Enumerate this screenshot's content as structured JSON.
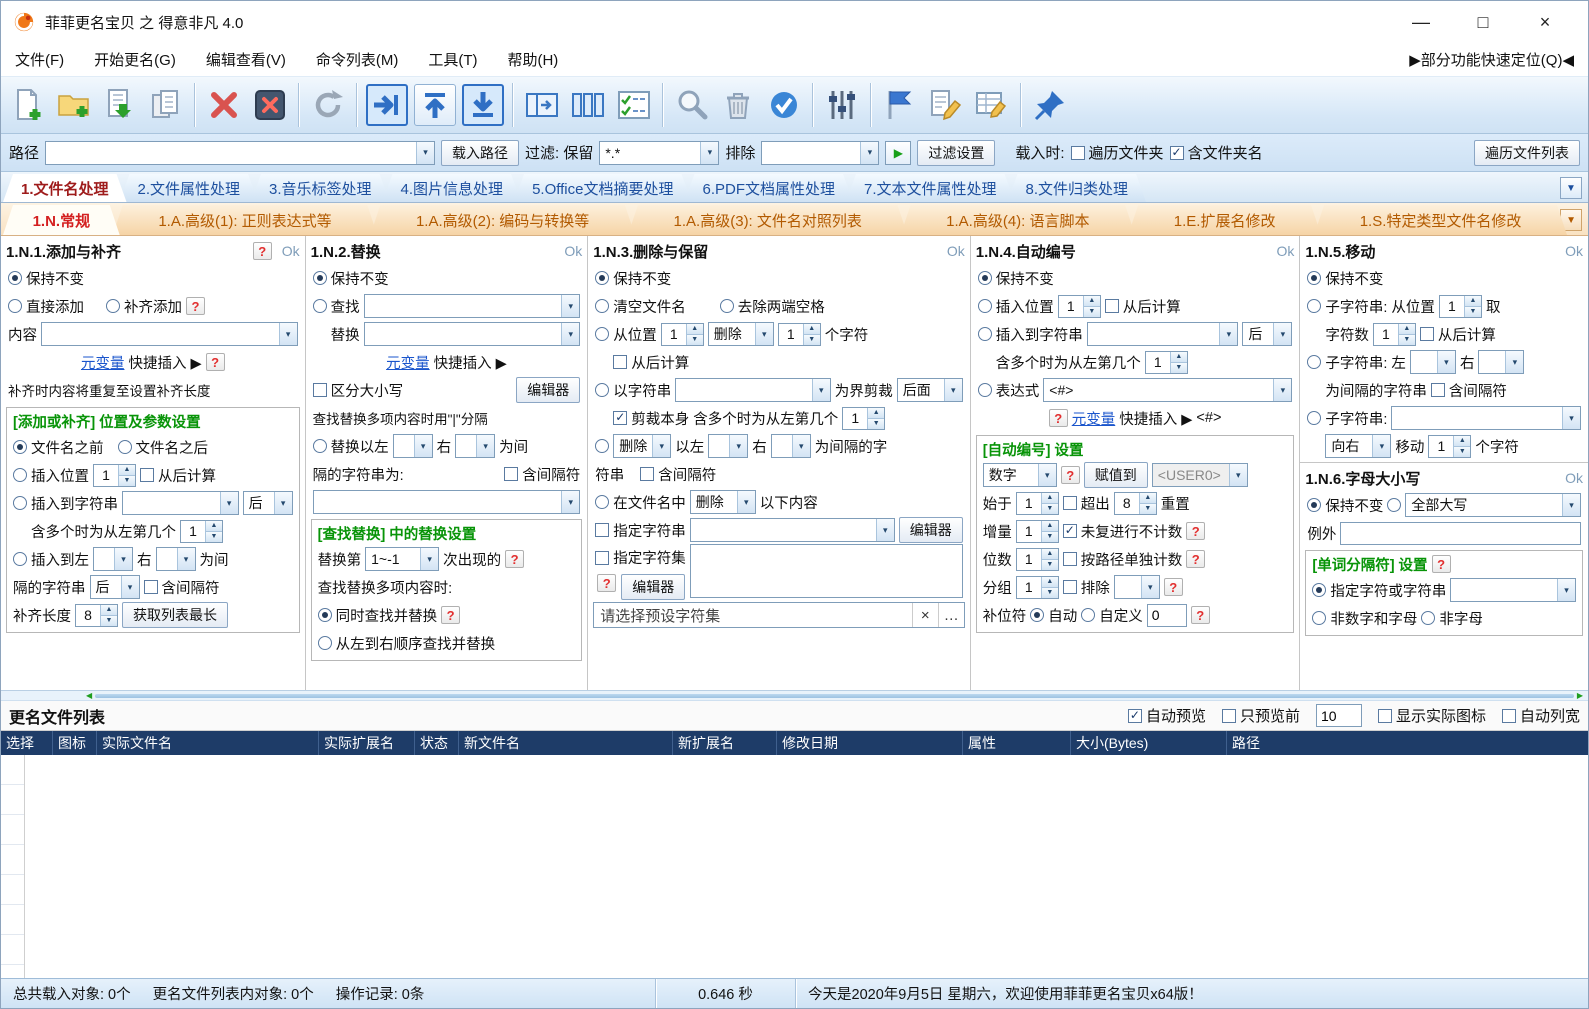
{
  "icons": {
    "combo_arrow": "▾",
    "spin_up": "▲",
    "spin_down": "▼",
    "dropdown_arrow": "▼",
    "play": "▶",
    "question": "?",
    "close_x": "×",
    "more": "…",
    "left_arrow": "◀",
    "right_arrow": "▶"
  },
  "window": {
    "title": "菲菲更名宝贝 之 得意非凡 4.0",
    "minimize": "—",
    "maximize": "□",
    "close": "×"
  },
  "menubar": {
    "items": [
      "文件(F)",
      "开始更名(G)",
      "编辑查看(V)",
      "命令列表(M)",
      "工具(T)",
      "帮助(H)"
    ],
    "quick_locate": "▶部分功能快速定位(Q)◀"
  },
  "toolbar": {
    "icons": [
      "new-list",
      "open-folder",
      "load-list",
      "save-list",
      "delete",
      "close-list",
      "refresh",
      "move-right",
      "move-up",
      "move-down",
      "split-view",
      "column-view",
      "form-view",
      "search",
      "clear-list",
      "apply",
      "options",
      "filter-flag",
      "edit-name",
      "edit-list",
      "pin"
    ]
  },
  "pathbar": {
    "path_label": "路径",
    "load_path_btn": "载入路径",
    "filter_label": "过滤: 保留",
    "filter_value": "*.*",
    "exclude_label": "排除",
    "filter_settings_btn": "过滤设置",
    "load_when_label": "载入时:",
    "traverse_folders_cb": "遍历文件夹",
    "include_folder_cb": "含文件夹名",
    "traverse_list_btn": "遍历文件列表"
  },
  "maintabs": [
    "1.文件名处理",
    "2.文件属性处理",
    "3.音乐标签处理",
    "4.图片信息处理",
    "5.Office文档摘要处理",
    "6.PDF文档属性处理",
    "7.文本文件属性处理",
    "8.文件归类处理"
  ],
  "subtabs": [
    "1.N.常规",
    "1.A.高级(1): 正则表达式等",
    "1.A.高级(2): 编码与转换等",
    "1.A.高级(3): 文件名对照列表",
    "1.A.高级(4): 语言脚本",
    "1.E.扩展名修改",
    "1.S.特定类型文件名修改"
  ],
  "p1": {
    "title": "1.N.1.添加与补齐",
    "ok": "Ok",
    "keep": "保持不变",
    "direct_add": "直接添加",
    "pad_add": "补齐添加",
    "content_label": "内容",
    "meta_link": "元变量",
    "meta_text": "快捷插入 ▶",
    "pad_note": "补齐时内容将重复至设置补齐长度",
    "group_title": "[添加或补齐] 位置及参数设置",
    "before_name": "文件名之前",
    "after_name": "文件名之后",
    "insert_pos": "插入位置",
    "insert_pos_value": "1",
    "from_end": "从后计算",
    "insert_to_str": "插入到字符串",
    "after_value": "后",
    "multi_label": "含多个时为从左第几个",
    "multi_value": "1",
    "between_left": "插入到左",
    "right_label": "右",
    "as_sep": "为间",
    "sep_label": "隔的字符串",
    "incl_sep": "含间隔符",
    "pad_len_label": "补齐长度",
    "pad_len_value": "8",
    "get_longest_btn": "获取列表最长"
  },
  "p2": {
    "title": "1.N.2.替换",
    "ok": "Ok",
    "keep": "保持不变",
    "find_label": "查找",
    "replace_label": "替换",
    "meta_link": "元变量",
    "meta_text": "快捷插入 ▶",
    "case_cb": "区分大小写",
    "editor_btn": "编辑器",
    "multi_note": "查找替换多项内容时用\"|\"分隔",
    "rep_between": "替换以左",
    "right_label": "右",
    "as_sep": "为间",
    "sep_label": "隔的字符串为:",
    "incl_sep": "含间隔符",
    "group_title": "[查找替换] 中的替换设置",
    "nth_label": "替换第",
    "nth_value": "1~-1",
    "nth_suffix": "次出现的",
    "multi_when": "查找替换多项内容时:",
    "simultaneous": "同时查找并替换",
    "sequential": "从左到右顺序查找并替换"
  },
  "p3": {
    "title": "1.N.3.删除与保留",
    "ok": "Ok",
    "keep": "保持不变",
    "clear_name": "清空文件名",
    "trim_spaces": "去除两端空格",
    "from_pos": "从位置",
    "from_pos_value": "1",
    "del_value": "删除",
    "count_value": "1",
    "chars_suffix": "个字符",
    "from_end": "从后计算",
    "by_string": "以字符串",
    "cut_label": "为界剪裁",
    "cut_side_value": "后面",
    "cut_self": "剪裁本身",
    "multi_label": "含多个时为从左第几个",
    "multi_value": "1",
    "del2_value": "删除",
    "left_label": "以左",
    "right_label": "右",
    "sep_suffix": "为间隔的字",
    "sep_suffix2": "符串",
    "incl_sep": "含间隔符",
    "in_name": "在文件名中",
    "in_name_value": "删除",
    "in_name_suffix": "以下内容",
    "spec_str_cb": "指定字符串",
    "editor_btn": "编辑器",
    "spec_set_cb": "指定字符集",
    "preset_placeholder": "请选择预设字符集"
  },
  "p4": {
    "title": "1.N.4.自动编号",
    "ok": "Ok",
    "keep": "保持不变",
    "insert_pos": "插入位置",
    "insert_pos_value": "1",
    "from_end": "从后计算",
    "insert_to_str": "插入到字符串",
    "after_value": "后",
    "multi_label": "含多个时为从左第几个",
    "multi_value": "1",
    "expr_label": "表达式",
    "expr_value": "<#>",
    "meta_link": "元变量",
    "meta_text": "快捷插入 ▶",
    "meta_tag": "<#>",
    "group_title": "[自动编号] 设置",
    "type_value": "数字",
    "assign_btn": "赋值到",
    "assign_value": "<USER0>",
    "start_label": "始于",
    "start_value": "1",
    "overflow_cb": "超出",
    "overflow_value": "8",
    "reset_label": "重置",
    "inc_label": "增量",
    "inc_value": "1",
    "nocount_cb": "未复进行不计数",
    "digits_label": "位数",
    "digits_value": "1",
    "perpath_cb": "按路径单独计数",
    "group_label": "分组",
    "group_value": "1",
    "exclude_cb": "排除",
    "pad_label": "补位符",
    "auto_label": "自动",
    "custom_label": "自定义",
    "custom_value": "0"
  },
  "p5": {
    "title": "1.N.5.移动",
    "ok": "Ok",
    "keep": "保持不变",
    "sub_from": "子字符串: 从位置",
    "from_value": "1",
    "take": "取",
    "count_label": "字符数",
    "count_value": "1",
    "from_end": "从后计算",
    "sub_between": "子字符串: 左",
    "right_label": "右",
    "sep_label": "为间隔的字符串",
    "incl_sep": "含间隔符",
    "sub_label": "子字符串:",
    "dir_value": "向右",
    "move_label": "移动",
    "move_value": "1",
    "unit": "个字符"
  },
  "p6": {
    "title": "1.N.6.字母大小写",
    "ok": "Ok",
    "keep": "保持不变",
    "case_value": "全部大写",
    "except_label": "例外",
    "group_title": "[单词分隔符] 设置",
    "spec_label": "指定字符或字符串",
    "non_alnum": "非数字和字母",
    "non_alpha": "非字母"
  },
  "listbar": {
    "title": "更名文件列表",
    "auto_preview": "自动预览",
    "preview_first": "只预览前",
    "preview_count": "10",
    "show_icons": "显示实际图标",
    "auto_width": "自动列宽"
  },
  "table": {
    "columns": [
      "选择",
      "图标",
      "实际文件名",
      "实际扩展名",
      "状态",
      "新文件名",
      "新扩展名",
      "修改日期",
      "属性",
      "大小(Bytes)",
      "路径"
    ]
  },
  "statusbar": {
    "total": "总共载入对象: 0个",
    "list": "更名文件列表内对象: 0个",
    "records": "操作记录: 0条",
    "time": "0.646 秒",
    "message": "今天是2020年9月5日 星期六，欢迎使用菲菲更名宝贝x64版！"
  }
}
